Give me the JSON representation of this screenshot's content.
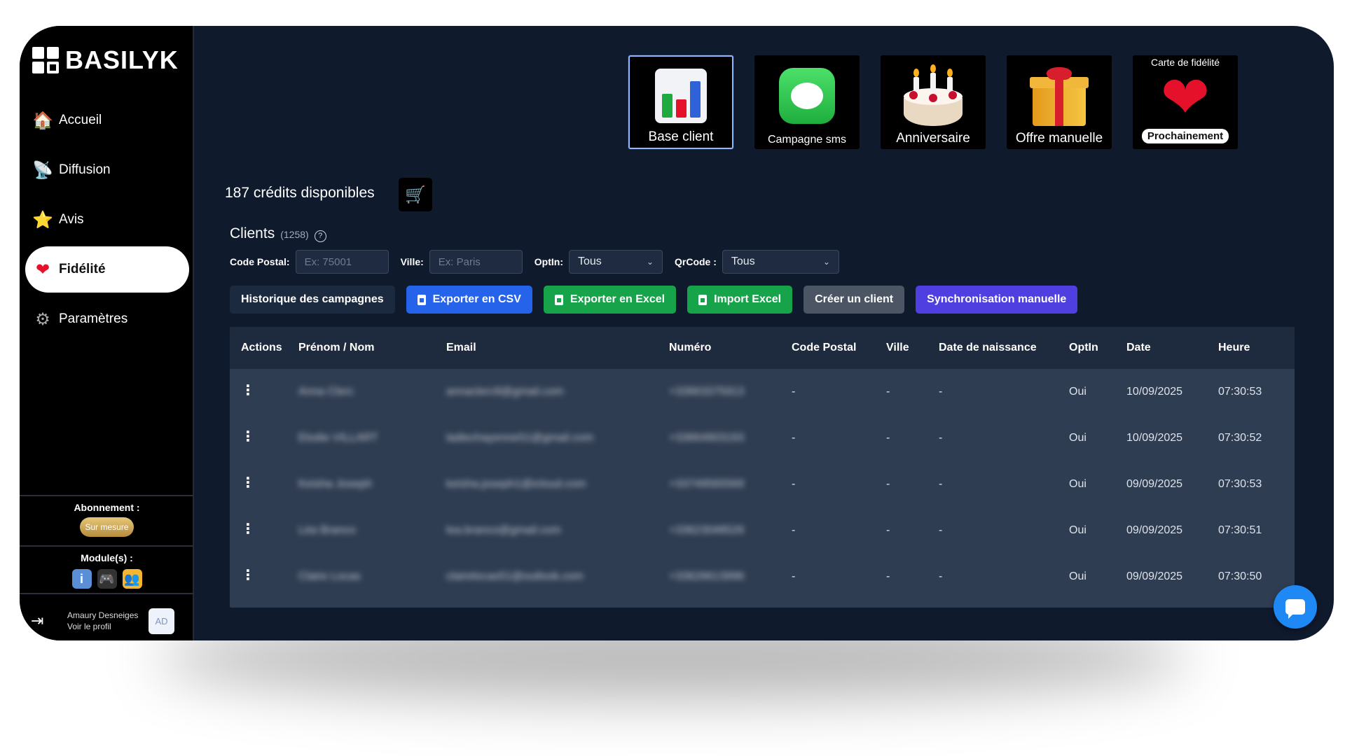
{
  "app": {
    "brand": "BASILYK"
  },
  "sidebar": {
    "items": [
      {
        "label": "Accueil",
        "icon": "house-icon"
      },
      {
        "label": "Diffusion",
        "icon": "satellite-icon"
      },
      {
        "label": "Avis",
        "icon": "star-icon"
      },
      {
        "label": "Fidélité",
        "icon": "heart-icon",
        "active": true
      },
      {
        "label": "Paramètres",
        "icon": "gear-icon"
      }
    ],
    "subscription": {
      "title": "Abonnement :",
      "badge": "Sur mesure"
    },
    "modules": {
      "title": "Module(s) :",
      "icons": [
        "info-icon",
        "gamepad-icon",
        "people-icon"
      ]
    },
    "profile": {
      "name": "Amaury Desneiges",
      "link": "Voir le profil",
      "initials": "AD"
    }
  },
  "tiles": [
    {
      "label": "Base client",
      "selected": true
    },
    {
      "label": "Campagne sms"
    },
    {
      "label": "Anniversaire"
    },
    {
      "label": "Offre manuelle"
    },
    {
      "label": "Prochainement",
      "top_label": "Carte de fidélité"
    }
  ],
  "credits": {
    "text": "187 crédits disponibles"
  },
  "clients": {
    "title": "Clients",
    "count": "(1258)"
  },
  "filters": {
    "postal": {
      "label": "Code Postal:",
      "placeholder": "Ex: 75001"
    },
    "city": {
      "label": "Ville:",
      "placeholder": "Ex: Paris"
    },
    "optin": {
      "label": "OptIn:",
      "value": "Tous"
    },
    "qrcode": {
      "label": "QrCode :",
      "value": "Tous"
    }
  },
  "actions": {
    "history": "Historique des campagnes",
    "export_csv": "Exporter en CSV",
    "export_excel": "Exporter en Excel",
    "import_excel": "Import Excel",
    "create_client": "Créer un client",
    "sync": "Synchronisation manuelle"
  },
  "colors": {
    "export_csv": "#2563eb",
    "excel": "#16a34a",
    "create": "#4b5563",
    "sync": "#4f3ee0",
    "badge_gold": "#c9a14f",
    "chat": "#1e88f5"
  },
  "table": {
    "headers": [
      "Actions",
      "Prénom / Nom",
      "Email",
      "Numéro",
      "Code Postal",
      "Ville",
      "Date de naissance",
      "OptIn",
      "Date",
      "Heure"
    ],
    "rows": [
      {
        "name": "Anna Clerc",
        "email": "annaclerc8@gmail.com",
        "number": "+33663375913",
        "cp": "-",
        "city": "-",
        "dob": "-",
        "optin": "Oui",
        "date": "10/09/2025",
        "time": "07:30:53"
      },
      {
        "name": "Elodie VILLART",
        "email": "ladiechayenne51@gmail.com",
        "number": "+33664903193",
        "cp": "-",
        "city": "-",
        "dob": "-",
        "optin": "Oui",
        "date": "10/09/2025",
        "time": "07:30:52"
      },
      {
        "name": "Keisha Joseph",
        "email": "keisha.joseph1@icloud.com",
        "number": "+33749565569",
        "cp": "-",
        "city": "-",
        "dob": "-",
        "optin": "Oui",
        "date": "09/09/2025",
        "time": "07:30:53"
      },
      {
        "name": "Léa Branco",
        "email": "lea.branco@gmail.com",
        "number": "+33623048526",
        "cp": "-",
        "city": "-",
        "dob": "-",
        "optin": "Oui",
        "date": "09/09/2025",
        "time": "07:30:51"
      },
      {
        "name": "Claire Locas",
        "email": "clairelocas51@outlook.com",
        "number": "+33626613996",
        "cp": "-",
        "city": "-",
        "dob": "-",
        "optin": "Oui",
        "date": "09/09/2025",
        "time": "07:30:50"
      }
    ]
  }
}
